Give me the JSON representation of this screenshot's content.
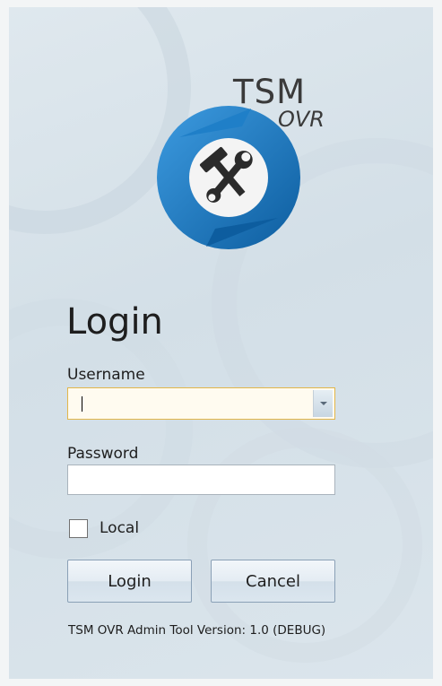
{
  "brand": {
    "main": "TSM",
    "sub": "OVR",
    "logo_icon": "hammer-wrench-refresh-icon",
    "colors": {
      "ring": "#1f7fc8",
      "ring_dark": "#0d5d9f",
      "center": "#f2f2f2",
      "tools": "#2b2b2b"
    }
  },
  "login": {
    "heading": "Login",
    "username_label": "Username",
    "username_value": "",
    "password_label": "Password",
    "password_value": "",
    "local_label": "Local",
    "local_checked": false,
    "login_button": "Login",
    "cancel_button": "Cancel"
  },
  "footer": {
    "version": "TSM OVR Admin Tool Version: 1.0 (DEBUG)"
  },
  "colors": {
    "focused_border": "#e2b64a",
    "background": "#d3dfe7"
  }
}
